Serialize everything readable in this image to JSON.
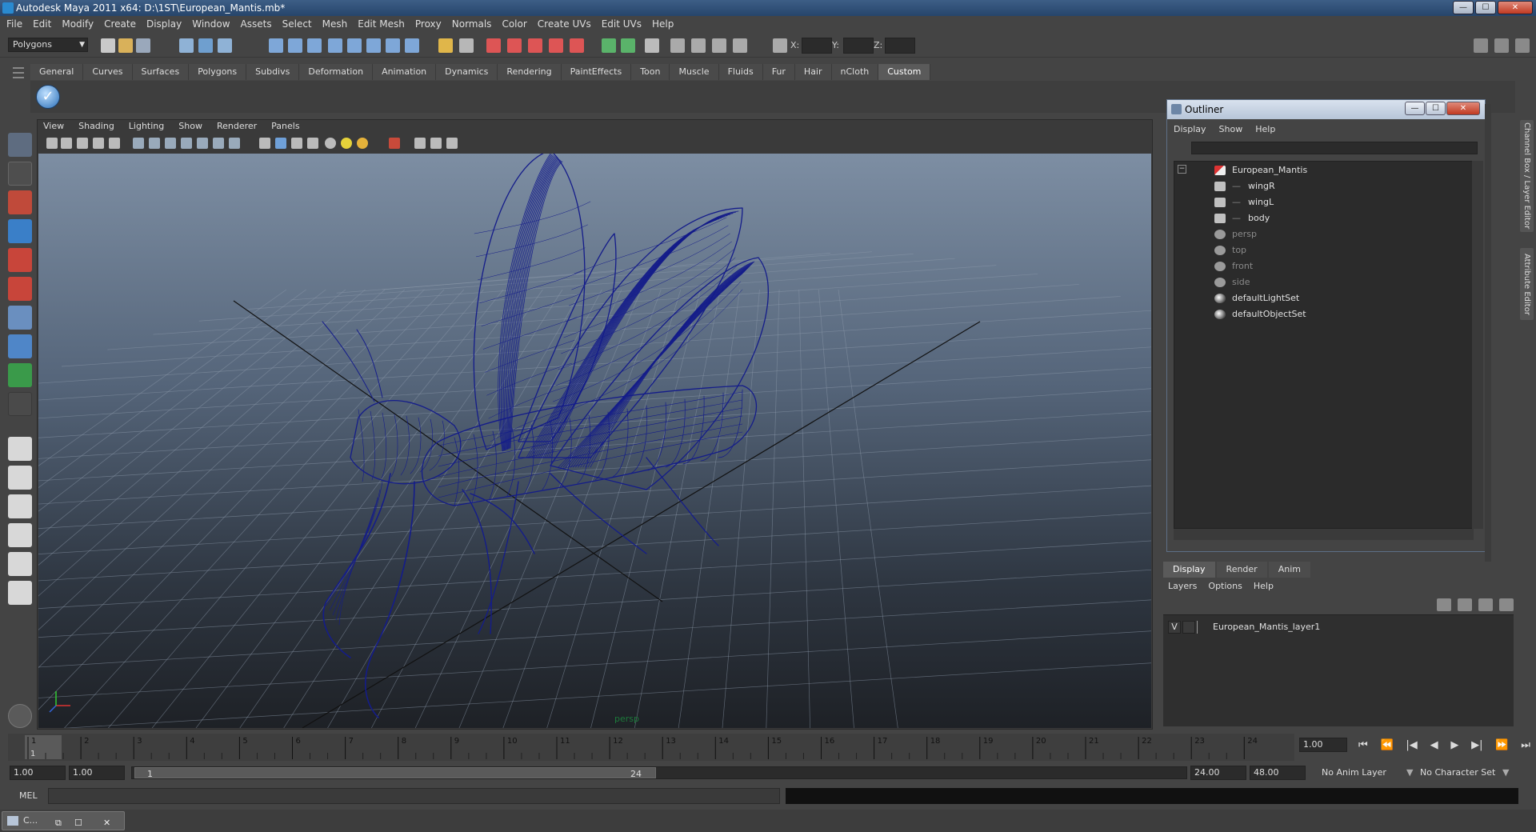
{
  "window": {
    "title": "Autodesk Maya 2011 x64: D:\\1ST\\European_Mantis.mb*",
    "min": "—",
    "max": "☐",
    "close": "✕"
  },
  "menubar": [
    "File",
    "Edit",
    "Modify",
    "Create",
    "Display",
    "Window",
    "Assets",
    "Select",
    "Mesh",
    "Edit Mesh",
    "Proxy",
    "Normals",
    "Color",
    "Create UVs",
    "Edit UVs",
    "Help"
  ],
  "status": {
    "mode": "Polygons",
    "x_label": "X:",
    "y_label": "Y:",
    "z_label": "Z:"
  },
  "shelf": {
    "tabs": [
      "General",
      "Curves",
      "Surfaces",
      "Polygons",
      "Subdivs",
      "Deformation",
      "Animation",
      "Dynamics",
      "Rendering",
      "PaintEffects",
      "Toon",
      "Muscle",
      "Fluids",
      "Fur",
      "Hair",
      "nCloth",
      "Custom"
    ],
    "active": "Custom"
  },
  "panel": {
    "menu": [
      "View",
      "Shading",
      "Lighting",
      "Show",
      "Renderer",
      "Panels"
    ],
    "camera": "persp"
  },
  "outliner": {
    "title": "Outliner",
    "menu": [
      "Display",
      "Show",
      "Help"
    ],
    "collapse": "−",
    "items": [
      {
        "label": "European_Mantis",
        "icon": "transform-icon",
        "dim": false
      },
      {
        "label": "wingR",
        "icon": "mesh-icon",
        "dim": false
      },
      {
        "label": "wingL",
        "icon": "mesh-icon",
        "dim": false
      },
      {
        "label": "body",
        "icon": "mesh-icon",
        "dim": false
      },
      {
        "label": "persp",
        "icon": "camera-icon",
        "dim": true
      },
      {
        "label": "top",
        "icon": "camera-icon",
        "dim": true
      },
      {
        "label": "front",
        "icon": "camera-icon",
        "dim": true
      },
      {
        "label": "side",
        "icon": "camera-icon",
        "dim": true
      },
      {
        "label": "defaultLightSet",
        "icon": "set-icon",
        "dim": false
      },
      {
        "label": "defaultObjectSet",
        "icon": "set-icon",
        "dim": false
      }
    ]
  },
  "side_tabs": [
    "Channel Box / Layer Editor",
    "Attribute Editor"
  ],
  "layers": {
    "tabs": [
      "Display",
      "Render",
      "Anim"
    ],
    "active": "Display",
    "menu": [
      "Layers",
      "Options",
      "Help"
    ],
    "rows": [
      {
        "visible": "V",
        "name": "European_Mantis_layer1"
      }
    ]
  },
  "timeline": {
    "ticks": [
      "1",
      "2",
      "3",
      "4",
      "5",
      "6",
      "7",
      "8",
      "9",
      "10",
      "11",
      "12",
      "13",
      "14",
      "15",
      "16",
      "17",
      "18",
      "19",
      "20",
      "21",
      "22",
      "23",
      "24"
    ],
    "current_marker": "1",
    "current_frame": "1.00",
    "range_start": "1.00",
    "playback_start": "1.00",
    "range_start_inner": "1",
    "range_end_inner": "24",
    "playback_end": "24.00",
    "range_end": "48.00",
    "anim_layer": "No Anim Layer",
    "char_set": "No Character Set",
    "controls": [
      "⏮",
      "⏪",
      "|◀",
      "◀",
      "▶",
      "▶|",
      "⏩",
      "⏭"
    ]
  },
  "cmd": {
    "label": "MEL"
  },
  "taskbar": {
    "label": "C...",
    "restore": "⧉",
    "max": "☐",
    "close": "✕"
  },
  "colors": {
    "wireframe": "#141c8a",
    "accent": "#2a6fb8"
  }
}
